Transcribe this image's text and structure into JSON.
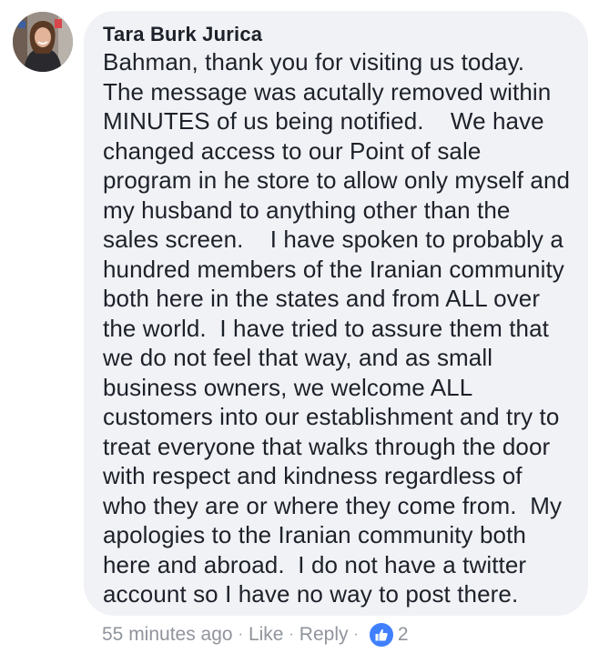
{
  "comment": {
    "author": "Tara Burk Jurica",
    "lines": [
      "Bahman, thank you for visiting us today.",
      "The message was acutally removed within",
      "MINUTES of us being notified.    We have",
      "changed access to our Point of sale",
      "program in he store to allow only myself and",
      "my husband to anything other than the",
      "sales screen.    I have spoken to probably a",
      "hundred members of the Iranian community",
      "both here in the states and from ALL over",
      "the world.  I have tried to assure them that",
      "we do not feel that way, and as small",
      "business owners, we welcome ALL",
      "customers into our establishment and try to",
      "treat everyone that walks through the door",
      "with respect and kindness regardless of",
      "who they are or where they come from.  My",
      "apologies to the Iranian community both",
      "here and abroad.  I do not have a twitter",
      "account so I have no way to post there."
    ]
  },
  "meta": {
    "timestamp": "55 minutes ago",
    "separator": "·",
    "like_label": "Like",
    "reply_label": "Reply",
    "reaction_icon": "thumbs-up-icon",
    "reaction_count": "2"
  },
  "colors": {
    "bubble_bg": "#f1f2f6",
    "text": "#1d2129",
    "meta_text": "#90949c",
    "like_blue": "#4080ff"
  }
}
